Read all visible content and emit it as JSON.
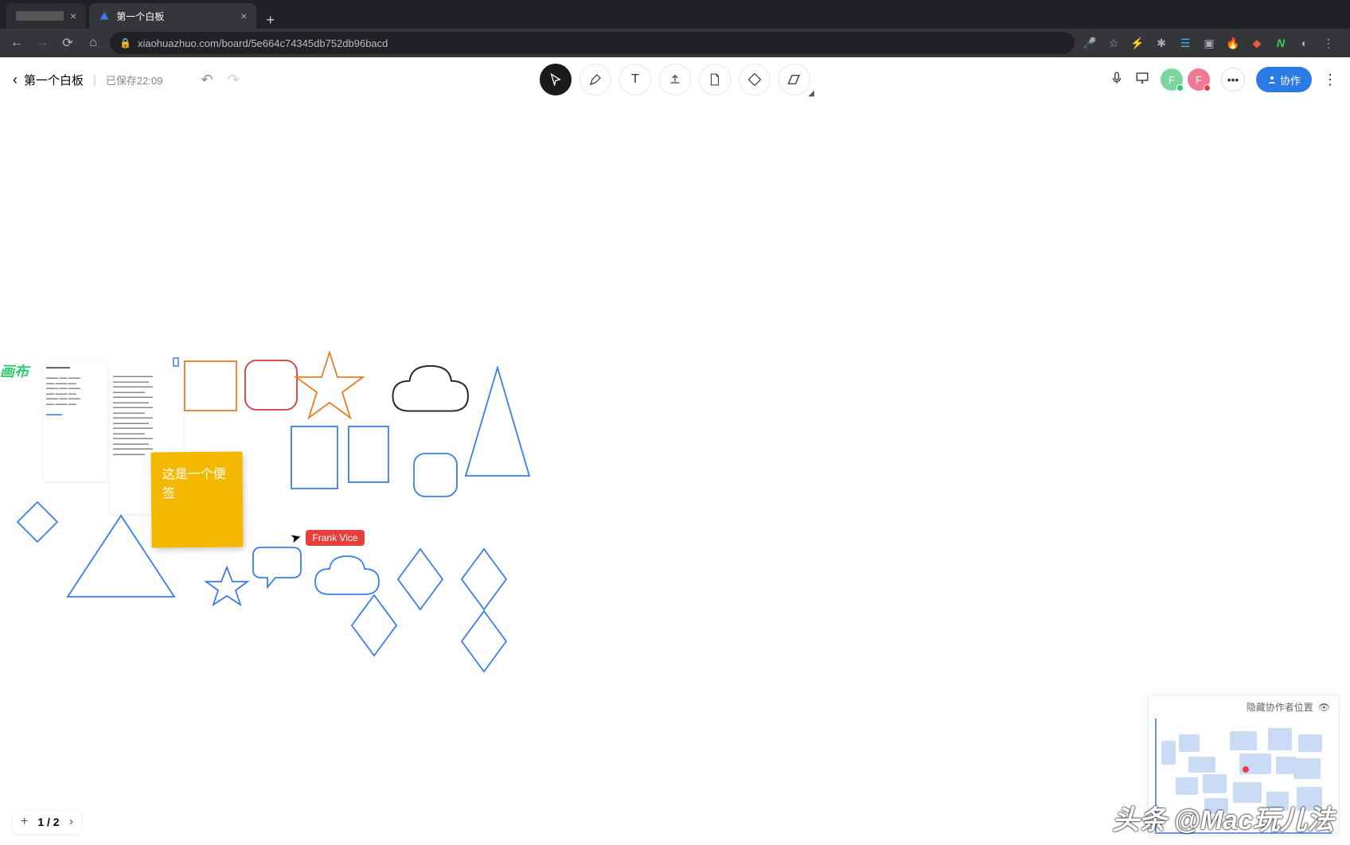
{
  "browser": {
    "tabs": [
      {
        "title": "",
        "active": false
      },
      {
        "title": "第一个白板",
        "active": true
      }
    ],
    "url": "xiaohuazhuo.com/board/5e664c74345db752db96bacd"
  },
  "app": {
    "title": "第一个白板",
    "save_status": "已保存22:09",
    "collab_btn": "协作",
    "tools": {
      "select": "select",
      "pen": "pen",
      "text": "text",
      "upload": "upload",
      "doc": "doc",
      "shape": "shape",
      "erase": "erase"
    }
  },
  "canvas": {
    "side_label": "画布",
    "sticky_note": "这是一个便签",
    "cursor_user": "Frank Vice"
  },
  "minimap": {
    "label": "隐藏协作者位置"
  },
  "pager": {
    "current": 1,
    "total": 2,
    "text": "1 / 2"
  },
  "watermark": "头条 @Mac玩儿法"
}
